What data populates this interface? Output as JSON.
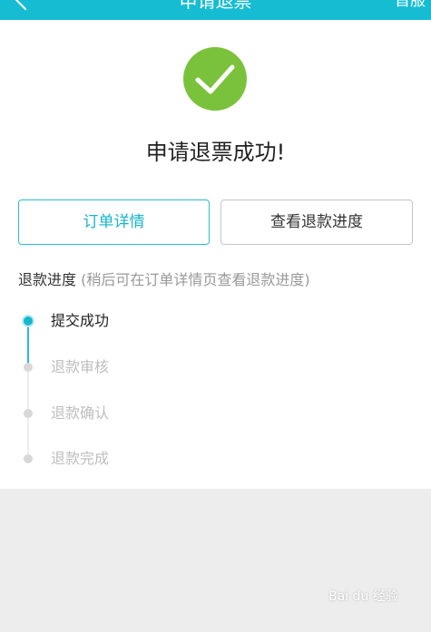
{
  "header": {
    "title": "申请退票",
    "right": "首服"
  },
  "result": {
    "message": "申请退票成功!"
  },
  "buttons": {
    "order_details": "订单详情",
    "view_progress": "查看退款进度"
  },
  "progress": {
    "title": "退款进度",
    "hint": "(稍后可在订单详情页查看退款进度)",
    "steps": [
      {
        "label": "提交成功",
        "status": "done"
      },
      {
        "label": "退款审核",
        "status": "pending"
      },
      {
        "label": "退款确认",
        "status": "pending"
      },
      {
        "label": "退款完成",
        "status": "pending"
      }
    ]
  },
  "watermark": "Bai du 经验",
  "colors": {
    "accent": "#16bdd2",
    "success": "#7bc23c"
  }
}
